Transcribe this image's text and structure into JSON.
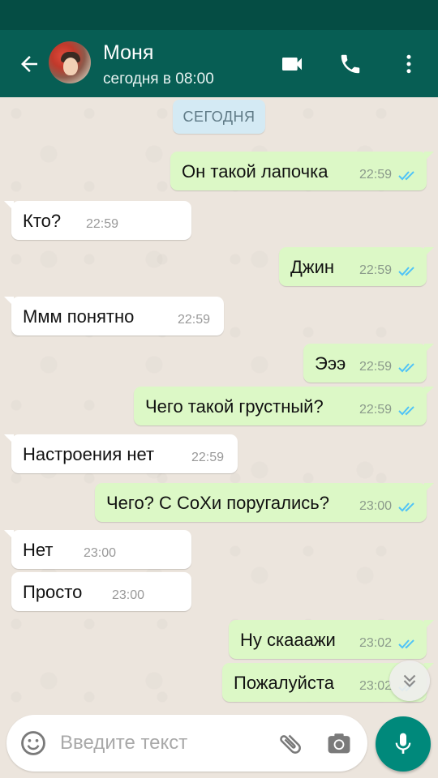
{
  "header": {
    "contact_name": "Моня",
    "contact_status": "сегодня в 08:00"
  },
  "icons": {
    "back": "arrow-left-icon",
    "video": "video-camera-icon",
    "call": "phone-icon",
    "menu": "more-vertical-icon",
    "read": "double-check-icon",
    "scroll": "chevron-double-down-icon",
    "emoji": "emoji-icon",
    "attach": "paperclip-icon",
    "camera": "camera-icon",
    "mic": "microphone-icon"
  },
  "colors": {
    "app_bar": "#075e54",
    "status_bar": "#054d44",
    "outgoing_bubble": "#dcf8c6",
    "incoming_bubble": "#ffffff",
    "read_ticks": "#4fc3f7",
    "mic_button": "#00897b"
  },
  "chat": {
    "date_chip": "СЕГОДНЯ",
    "messages": [
      {
        "dir": "out",
        "text": "Он такой лапочка",
        "time": "22:59",
        "read": true
      },
      {
        "dir": "in",
        "text": "Кто?",
        "time": "22:59"
      },
      {
        "dir": "out",
        "text": "Джин",
        "time": "22:59",
        "read": true
      },
      {
        "dir": "in",
        "text": "Ммм понятно",
        "time": "22:59"
      },
      {
        "dir": "out",
        "text": "Эээ",
        "time": "22:59",
        "read": true
      },
      {
        "dir": "out",
        "text": "Чего такой грустный?",
        "time": "22:59",
        "read": true
      },
      {
        "dir": "in",
        "text": "Настроения нет",
        "time": "22:59"
      },
      {
        "dir": "out",
        "text": "Чего? С СоХи поругались?",
        "time": "23:00",
        "read": true
      },
      {
        "dir": "in",
        "text": "Нет",
        "time": "23:00"
      },
      {
        "dir": "in",
        "text": "Просто",
        "time": "23:00"
      },
      {
        "dir": "out",
        "text": "Ну скааажи",
        "time": "23:02",
        "read": true
      },
      {
        "dir": "out",
        "text": "Пожалуйста",
        "time": "23:02",
        "read": true
      }
    ]
  },
  "composer": {
    "placeholder": "Введите текст"
  }
}
